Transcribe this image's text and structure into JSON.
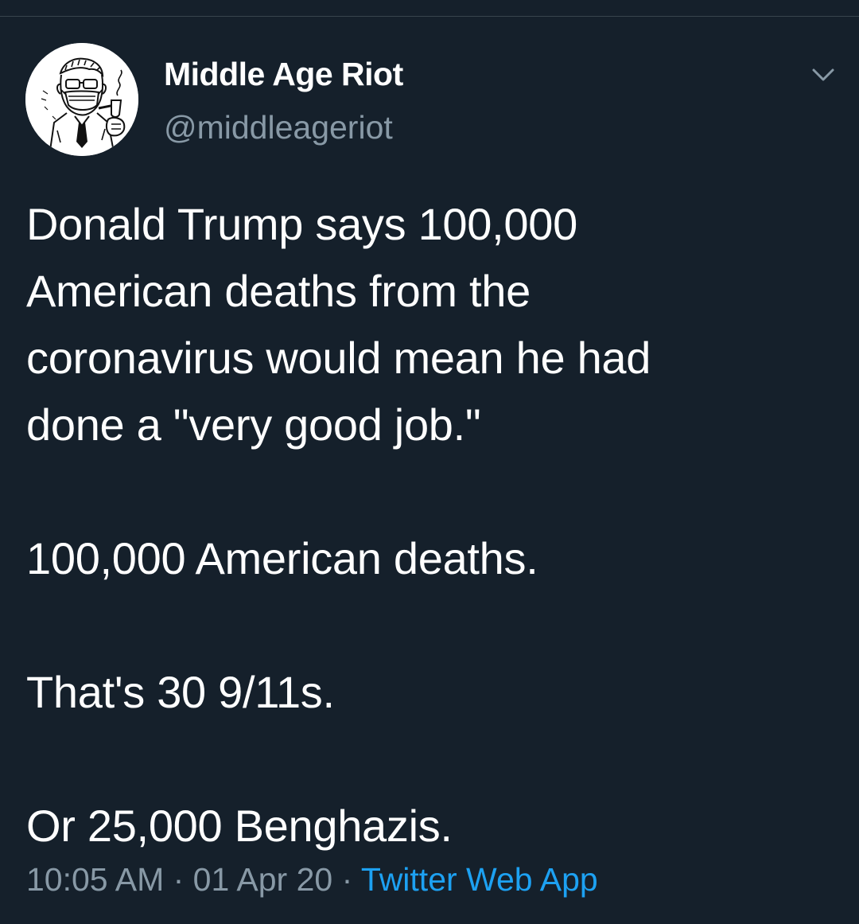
{
  "user": {
    "display_name": "Middle Age Riot",
    "handle": "@middleageriot",
    "avatar_icon": "masked-man-with-pipe-avatar"
  },
  "menu": {
    "icon": "chevron-down-icon"
  },
  "tweet": {
    "paragraph_1_lines": [
      "Donald Trump says 100,000",
      "American deaths from the",
      "coronavirus would mean he had",
      "done a \"very good job.\""
    ],
    "paragraph_2": "100,000 American deaths.",
    "paragraph_3": "That's 30 9/11s.",
    "paragraph_4": "Or 25,000 Benghazis."
  },
  "meta": {
    "time": "10:05 AM",
    "separator": " · ",
    "date": "01 Apr 20",
    "source": "Twitter Web App"
  },
  "colors": {
    "background": "#15202b",
    "text_primary": "#ffffff",
    "text_secondary": "#8899a6",
    "link": "#1da1f2"
  }
}
